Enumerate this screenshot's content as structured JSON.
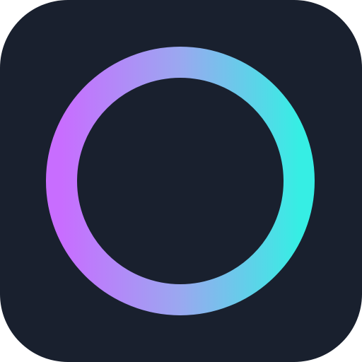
{
  "icon": {
    "name": "ring-app-icon",
    "background_color": "#19202e",
    "ring": {
      "gradient_start": "#c86dff",
      "gradient_mid": "#9aa8f0",
      "gradient_end": "#36eee4"
    }
  }
}
